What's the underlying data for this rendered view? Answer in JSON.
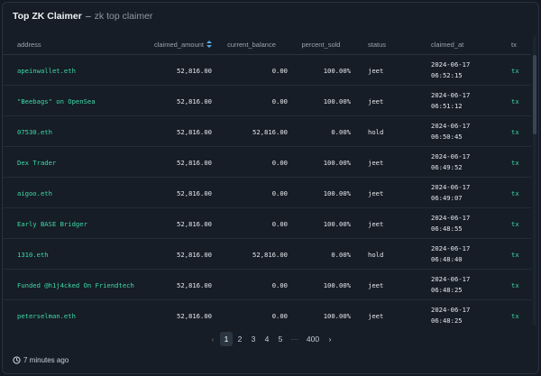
{
  "header": {
    "title": "Top ZK Claimer",
    "separator": "–",
    "subtitle": "zk top claimer"
  },
  "columns": {
    "address": "address",
    "claimed_amount": "claimed_amount",
    "current_balance": "current_balance",
    "percent_sold": "percent_sold",
    "status": "status",
    "claimed_at": "claimed_at",
    "tx": "tx"
  },
  "rows": [
    {
      "address": "apeinwallet.eth",
      "claimed_amount": "52,816.00",
      "current_balance": "0.00",
      "percent_sold": "100.00%",
      "status": "jeet",
      "date": "2024-06-17",
      "time": "06:52:15",
      "tx": "tx"
    },
    {
      "address": "\"Beebags\" on OpenSea",
      "claimed_amount": "52,816.00",
      "current_balance": "0.00",
      "percent_sold": "100.00%",
      "status": "jeet",
      "date": "2024-06-17",
      "time": "06:51:12",
      "tx": "tx"
    },
    {
      "address": "07530.eth",
      "claimed_amount": "52,816.00",
      "current_balance": "52,816.00",
      "percent_sold": "0.00%",
      "status": "hold",
      "date": "2024-06-17",
      "time": "06:50:45",
      "tx": "tx"
    },
    {
      "address": "Dex Trader",
      "claimed_amount": "52,816.00",
      "current_balance": "0.00",
      "percent_sold": "100.00%",
      "status": "jeet",
      "date": "2024-06-17",
      "time": "06:49:52",
      "tx": "tx"
    },
    {
      "address": "aigoo.eth",
      "claimed_amount": "52,816.00",
      "current_balance": "0.00",
      "percent_sold": "100.00%",
      "status": "jeet",
      "date": "2024-06-17",
      "time": "06:49:07",
      "tx": "tx"
    },
    {
      "address": "Early BASE Bridger",
      "claimed_amount": "52,816.00",
      "current_balance": "0.00",
      "percent_sold": "100.00%",
      "status": "jeet",
      "date": "2024-06-17",
      "time": "06:48:55",
      "tx": "tx"
    },
    {
      "address": "1310.eth",
      "claimed_amount": "52,816.00",
      "current_balance": "52,816.00",
      "percent_sold": "0.00%",
      "status": "hold",
      "date": "2024-06-17",
      "time": "06:48:40",
      "tx": "tx"
    },
    {
      "address": "Funded @h1j4cked On Friendtech",
      "claimed_amount": "52,816.00",
      "current_balance": "0.00",
      "percent_sold": "100.00%",
      "status": "jeet",
      "date": "2024-06-17",
      "time": "06:48:25",
      "tx": "tx"
    },
    {
      "address": "peterselman.eth",
      "claimed_amount": "52,816.00",
      "current_balance": "0.00",
      "percent_sold": "100.00%",
      "status": "jeet",
      "date": "2024-06-17",
      "time": "06:48:25",
      "tx": "tx"
    }
  ],
  "pagination": {
    "prev": "‹",
    "pages": [
      "1",
      "2",
      "3",
      "4",
      "5"
    ],
    "ellipsis": "···",
    "last": "400",
    "next": "›",
    "current": "1"
  },
  "footer": {
    "updated": "7 minutes ago"
  },
  "colors": {
    "link": "#3dd9a8",
    "background": "#161d26",
    "sort_icon": "#5aa9e6"
  },
  "icons": {
    "sort": "sort-arrows-icon",
    "clock": "clock-icon"
  }
}
